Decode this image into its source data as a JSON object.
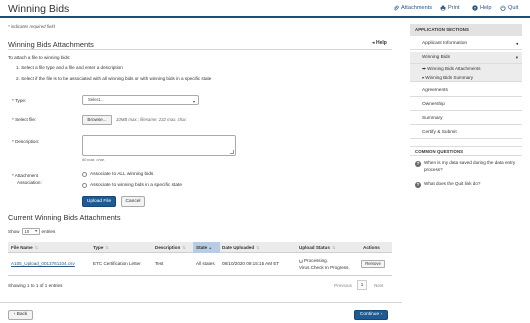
{
  "header": {
    "title": "Winning Bids",
    "links": {
      "attachments": "Attachments",
      "print": "Print",
      "help": "Help",
      "quit": "Quit"
    }
  },
  "required_note": "* indicates required field",
  "section": {
    "title": "Winning Bids Attachments",
    "help": "Help"
  },
  "instructions": {
    "intro": "To attach a file to winning bids:",
    "step1": "1. Select a file type and a file and enter a description",
    "step2": "2. Select if the file is to be associated with all winning bids or with winning bids in a specific state"
  },
  "form": {
    "type_label": "* Type:",
    "type_value": "Select...",
    "file_label": "* Select file:",
    "browse_label": "Browse...",
    "file_hint": "10MB max.; filename: 232 max. char.",
    "description_label": "* Description:",
    "description_hint": "60 max. char.",
    "association_label_1": "* Attachment",
    "association_label_2": "Association:",
    "radio_all": "Associate to ALL winning bids",
    "radio_state": "Associate to winning bids in a specific state",
    "upload_label": "Upload File",
    "cancel_label": "Cancel"
  },
  "current": {
    "title": "Current Winning Bids Attachments",
    "show_prefix": "Show",
    "show_value": "10",
    "show_suffix": "entries",
    "columns": {
      "file_name": "File Name",
      "type": "Type",
      "description": "Description",
      "state": "State",
      "date_uploaded": "Date Uploaded",
      "upload_status": "Upload Status",
      "actions": "Actions"
    },
    "rows": [
      {
        "file_name": "A105_Upload_0013761104.csv",
        "type": "ETC Certification Letter",
        "description": "Test",
        "state": "All states",
        "date_uploaded": "08/10/2020 09:15:15 AM ET",
        "status_line1": "Processing.",
        "status_line2": "Virus Check In Progress.",
        "action": "Remove"
      }
    ],
    "showing": "Showing 1 to 1 of 1 entries",
    "previous": "Previous",
    "page": "1",
    "next": "Next"
  },
  "nav": {
    "back": "‹ Back",
    "continue": "Continue ›"
  },
  "sidebar": {
    "app_sections_title": "APPLICATION SECTIONS",
    "items": {
      "applicant_information": "Applicant Information",
      "winning_bids": "Winning Bids",
      "sub_attachments": "Winning Bids Attachments",
      "sub_summary": "Winning Bids Summary",
      "agreements": "Agreements",
      "ownership": "Ownership",
      "summary": "Summary",
      "certify_submit": "Certify & Submit"
    },
    "common_questions_title": "COMMON QUESTIONS",
    "questions": {
      "q1": "When is my data saved during the data entry process?",
      "q2": "What does the Quit link do?"
    }
  },
  "colors": {
    "primary_blue": "#1e5a94",
    "link_blue": "#2a5788",
    "active_column": "#b7cde3"
  }
}
